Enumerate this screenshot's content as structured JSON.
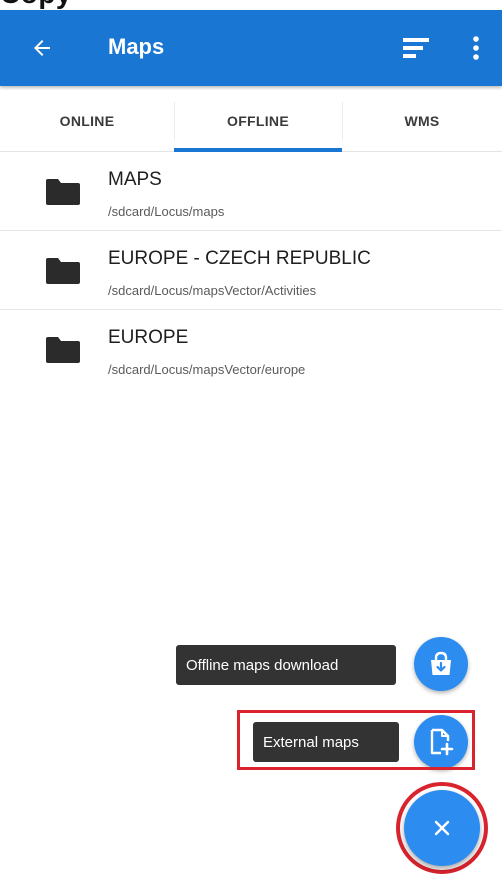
{
  "colors": {
    "primary": "#1976d2",
    "fab": "#2d8cf0",
    "highlight": "#d9232d",
    "folder": "#2b2b2b"
  },
  "header_fragment": "Copy",
  "appbar": {
    "title": "Maps",
    "back_icon": "arrow-left-icon",
    "sort_icon": "sort-icon",
    "more_icon": "more-vertical-icon"
  },
  "tabs": [
    {
      "label": "ONLINE",
      "selected": false
    },
    {
      "label": "OFFLINE",
      "selected": true
    },
    {
      "label": "WMS",
      "selected": false
    }
  ],
  "folders": [
    {
      "title": "MAPS",
      "path": "/sdcard/Locus/maps",
      "icon": "folder-icon"
    },
    {
      "title": "EUROPE - CZECH REPUBLIC",
      "path": "/sdcard/Locus/mapsVector/Activities",
      "icon": "folder-icon"
    },
    {
      "title": "EUROPE",
      "path": "/sdcard/Locus/mapsVector/europe",
      "icon": "folder-icon"
    }
  ],
  "fab_menu": {
    "download_label": "Offline maps download",
    "download_icon": "shopping-bag-download-icon",
    "external_label": "External maps",
    "external_icon": "file-add-icon",
    "close_label": "×",
    "close_icon": "close-icon"
  }
}
